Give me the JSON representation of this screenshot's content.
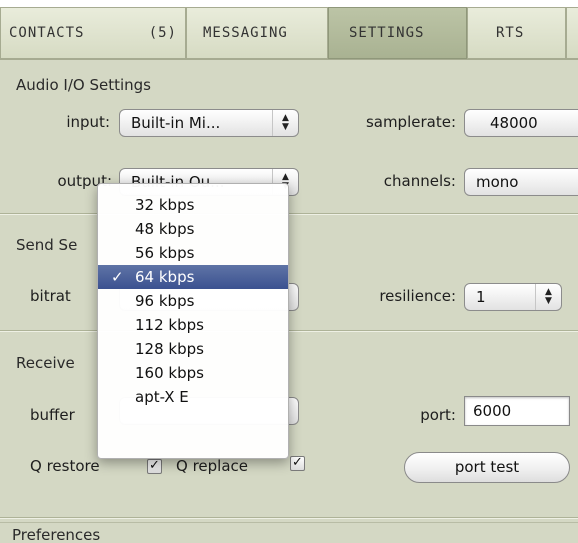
{
  "tabs": [
    {
      "label": "CONTACTS",
      "count": "(5)"
    },
    {
      "label": "MESSAGING"
    },
    {
      "label": "SETTINGS"
    },
    {
      "label": "RTS"
    }
  ],
  "audio_io": {
    "title": "Audio I/O Settings",
    "input_label": "input:",
    "input_value": "Built-in Mi...",
    "output_label": "output:",
    "output_value": "Built-in Ou...",
    "samplerate_label": "samplerate:",
    "samplerate_value": "48000",
    "channels_label": "channels:",
    "channels_value": "mono"
  },
  "send": {
    "title": "Send Se",
    "bitrate_label": "bitrat",
    "resilience_label": "resilience:",
    "resilience_value": "1"
  },
  "receive": {
    "title": "Receive",
    "buffer_label": "buffer",
    "port_label": "port:",
    "port_value": "6000",
    "q_restore_label": "Q restore",
    "q_replace_label": "Q replace",
    "port_test_label": "port test"
  },
  "preferences": {
    "title": "Preferences"
  },
  "bitrate_menu": {
    "checkmark": "✓",
    "items": [
      "32 kbps",
      "48 kbps",
      "56 kbps",
      "64 kbps",
      "96 kbps",
      "112 kbps",
      "128 kbps",
      "160 kbps",
      "apt-X E"
    ],
    "selected": "64 kbps"
  }
}
